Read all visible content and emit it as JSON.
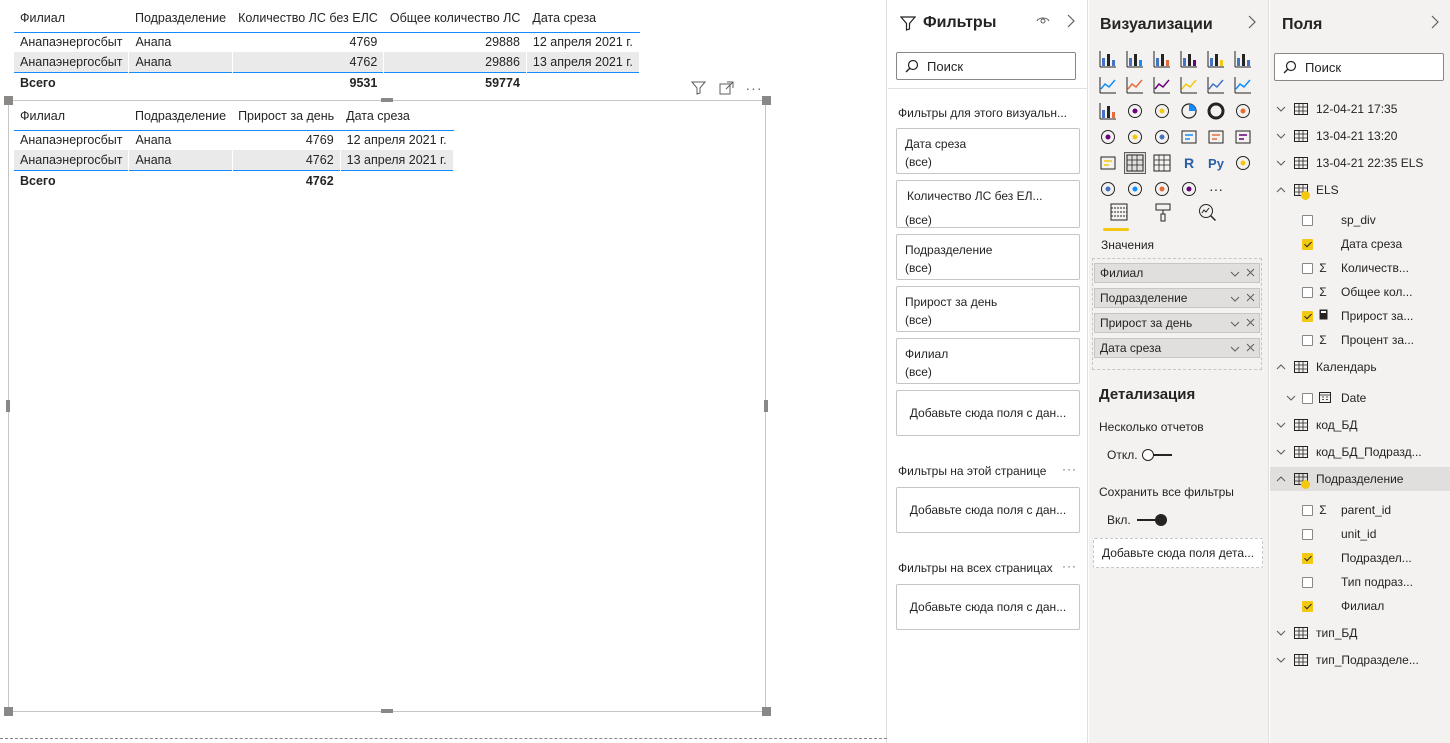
{
  "table1": {
    "headers": [
      "Филиал",
      "Подразделение",
      "Количество ЛС без ЕЛС",
      "Общее количество ЛС",
      "Дата среза"
    ],
    "rows": [
      [
        "Анапаэнергосбыт",
        "Анапа",
        "4769",
        "29888",
        "12 апреля 2021 г."
      ],
      [
        "Анапаэнергосбыт",
        "Анапа",
        "4762",
        "29886",
        "13 апреля 2021 г."
      ]
    ],
    "total": [
      "Всего",
      "",
      "9531",
      "59774",
      ""
    ]
  },
  "table2": {
    "headers": [
      "Филиал",
      "Подразделение",
      "Прирост за день",
      "Дата среза"
    ],
    "rows": [
      [
        "Анапаэнергосбыт",
        "Анапа",
        "4769",
        "12 апреля 2021 г."
      ],
      [
        "Анапаэнергосбыт",
        "Анапа",
        "4762",
        "13 апреля 2021 г."
      ]
    ],
    "total": [
      "Всего",
      "",
      "4762",
      ""
    ]
  },
  "visual_header": {
    "more": "···"
  },
  "filters": {
    "title": "Фильтры",
    "search_placeholder": "Поиск",
    "visual_section": "Фильтры для этого визуальн...",
    "cards": [
      {
        "name": "Дата среза",
        "value": "(все)"
      },
      {
        "name": "Количество ЛС без ЕЛ...",
        "value": "(все)"
      },
      {
        "name": "Подразделение",
        "value": "(все)"
      },
      {
        "name": "Прирост за день",
        "value": "(все)"
      },
      {
        "name": "Филиал",
        "value": "(все)"
      }
    ],
    "drop_visual": "Добавьте сюда поля с дан...",
    "page_section": "Фильтры на этой странице",
    "drop_page": "Добавьте сюда поля с дан...",
    "all_section": "Фильтры на всех страницах",
    "drop_all": "Добавьте сюда поля с дан...",
    "dots": "···"
  },
  "viz": {
    "title": "Визуализации",
    "values_label": "Значения",
    "wells": [
      "Филиал",
      "Подразделение",
      "Прирост за день",
      "Дата среза"
    ],
    "drill_title": "Детализация",
    "multi_reports": "Несколько отчетов",
    "multi_state": "Откл.",
    "keep_filters": "Сохранить все фильтры",
    "keep_state": "Вкл.",
    "drill_drop": "Добавьте сюда поля дета...",
    "r_label": "R",
    "py_label": "Py",
    "more": "···"
  },
  "fields": {
    "title": "Поля",
    "search_placeholder": "Поиск",
    "items": [
      {
        "label": "12-04-21 17:35",
        "type": "table",
        "level": 0,
        "expanded": false
      },
      {
        "label": "13-04-21 13:20",
        "type": "table",
        "level": 0,
        "expanded": false
      },
      {
        "label": "13-04-21 22:35 ELS",
        "type": "table",
        "level": 0,
        "expanded": false
      },
      {
        "label": "ELS",
        "type": "table",
        "level": 0,
        "expanded": true,
        "badge": true
      },
      {
        "label": "sp_div",
        "type": "field",
        "checked": false,
        "sigma": false
      },
      {
        "label": "Дата среза",
        "type": "field",
        "checked": true,
        "sigma": false
      },
      {
        "label": "Количеств...",
        "type": "field",
        "checked": false,
        "sigma": true
      },
      {
        "label": "Общее кол...",
        "type": "field",
        "checked": false,
        "sigma": true
      },
      {
        "label": "Прирост за...",
        "type": "field",
        "checked": true,
        "calc": true
      },
      {
        "label": "Процент за...",
        "type": "field",
        "checked": false,
        "sigma": true
      },
      {
        "label": "Календарь",
        "type": "table",
        "level": 0,
        "expanded": true
      },
      {
        "label": "Date",
        "type": "hier",
        "checked": false
      },
      {
        "label": "код_БД",
        "type": "table",
        "level": 0,
        "expanded": false
      },
      {
        "label": "код_БД_Подразд...",
        "type": "table",
        "level": 0,
        "expanded": false
      },
      {
        "label": "Подразделение",
        "type": "table",
        "level": 0,
        "expanded": true,
        "badge": true,
        "highlight": true
      },
      {
        "label": "parent_id",
        "type": "field",
        "checked": false,
        "sigma": true
      },
      {
        "label": "unit_id",
        "type": "field",
        "checked": false,
        "sigma": false
      },
      {
        "label": "Подраздел...",
        "type": "field",
        "checked": true,
        "sigma": false
      },
      {
        "label": "Тип подраз...",
        "type": "field",
        "checked": false,
        "sigma": false
      },
      {
        "label": "Филиал",
        "type": "field",
        "checked": true,
        "sigma": false
      },
      {
        "label": "тип_БД",
        "type": "table",
        "level": 0,
        "expanded": false
      },
      {
        "label": "тип_Подразделе...",
        "type": "table",
        "level": 0,
        "expanded": false
      }
    ]
  },
  "colors": {
    "accent": "#f2c811",
    "table_line": "#118dff"
  }
}
